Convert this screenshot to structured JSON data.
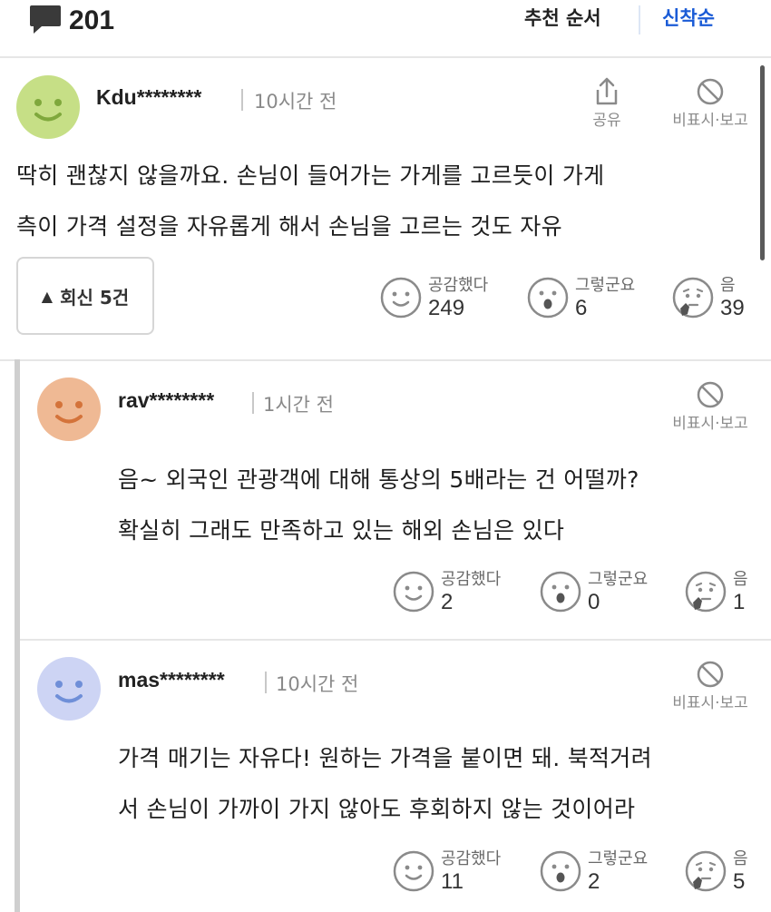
{
  "header": {
    "comment_count": "201",
    "sort_recommended": "추천 순서",
    "sort_newest": "신착순",
    "active_sort_color": "#1a5bd6"
  },
  "comments": [
    {
      "user": "Kdu********",
      "time": "10시간 전",
      "share_label": "공유",
      "report_label": "비표시·보고",
      "lines": [
        "딱히 괜찮지 않을까요. 손님이 들어가는 가게를 고르듯이 가게",
        "측이 가격 설정을 자유롭게 해서 손님을 고르는 것도 자유"
      ],
      "reply_button": "회신 5건",
      "avatar_color": "#c6df86",
      "reactions": [
        {
          "label": "공감했다",
          "count": "249"
        },
        {
          "label": "그렇군요",
          "count": "6"
        },
        {
          "label": "음",
          "count": "39"
        }
      ]
    },
    {
      "user": "rav********",
      "time": "1시간 전",
      "report_label": "비표시·보고",
      "lines": [
        "음~ 외국인 관광객에 대해 통상의 5배라는 건 어떨까?",
        "확실히 그래도 만족하고 있는 해외 손님은 있다"
      ],
      "avatar_color": "#efb994",
      "reactions": [
        {
          "label": "공감했다",
          "count": "2"
        },
        {
          "label": "그렇군요",
          "count": "0"
        },
        {
          "label": "음",
          "count": "1"
        }
      ]
    },
    {
      "user": "mas********",
      "time": "10시간 전",
      "report_label": "비표시·보고",
      "lines": [
        "가격 매기는 자유다! 원하는 가격을 붙이면 돼. 북적거려",
        "서 손님이 가까이 가지 않아도 후회하지 않는 것이어라"
      ],
      "avatar_color": "#cdd4f4",
      "reactions": [
        {
          "label": "공감했다",
          "count": "11"
        },
        {
          "label": "그렇군요",
          "count": "2"
        },
        {
          "label": "음",
          "count": "5"
        }
      ]
    }
  ]
}
